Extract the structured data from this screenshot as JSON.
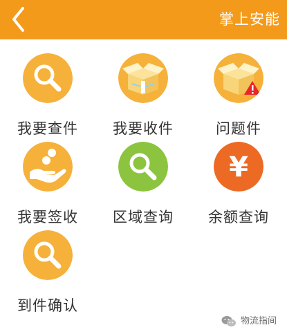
{
  "header": {
    "title": "掌上安能",
    "background_color": "#f49a1b",
    "back_icon": "chevron-left-icon"
  },
  "menu": {
    "items": [
      {
        "label": "我要查件",
        "icon": "search-icon",
        "color": "#f6b13a"
      },
      {
        "label": "我要收件",
        "icon": "open-box-icon",
        "color": "#f6b13a"
      },
      {
        "label": "问题件",
        "icon": "box-warning-icon",
        "color": "#f6b13a"
      },
      {
        "label": "我要签收",
        "icon": "hand-coins-icon",
        "color": "#f6b13a"
      },
      {
        "label": "区域查询",
        "icon": "search-icon",
        "color": "#8cc43f"
      },
      {
        "label": "余额查询",
        "icon": "yen-icon",
        "color": "#ec6a23",
        "glyph": "¥"
      },
      {
        "label": "到件确认",
        "icon": "search-icon",
        "color": "#f6b13a"
      }
    ]
  },
  "watermark": {
    "text": "物流指间",
    "icon": "wechat-icon"
  }
}
